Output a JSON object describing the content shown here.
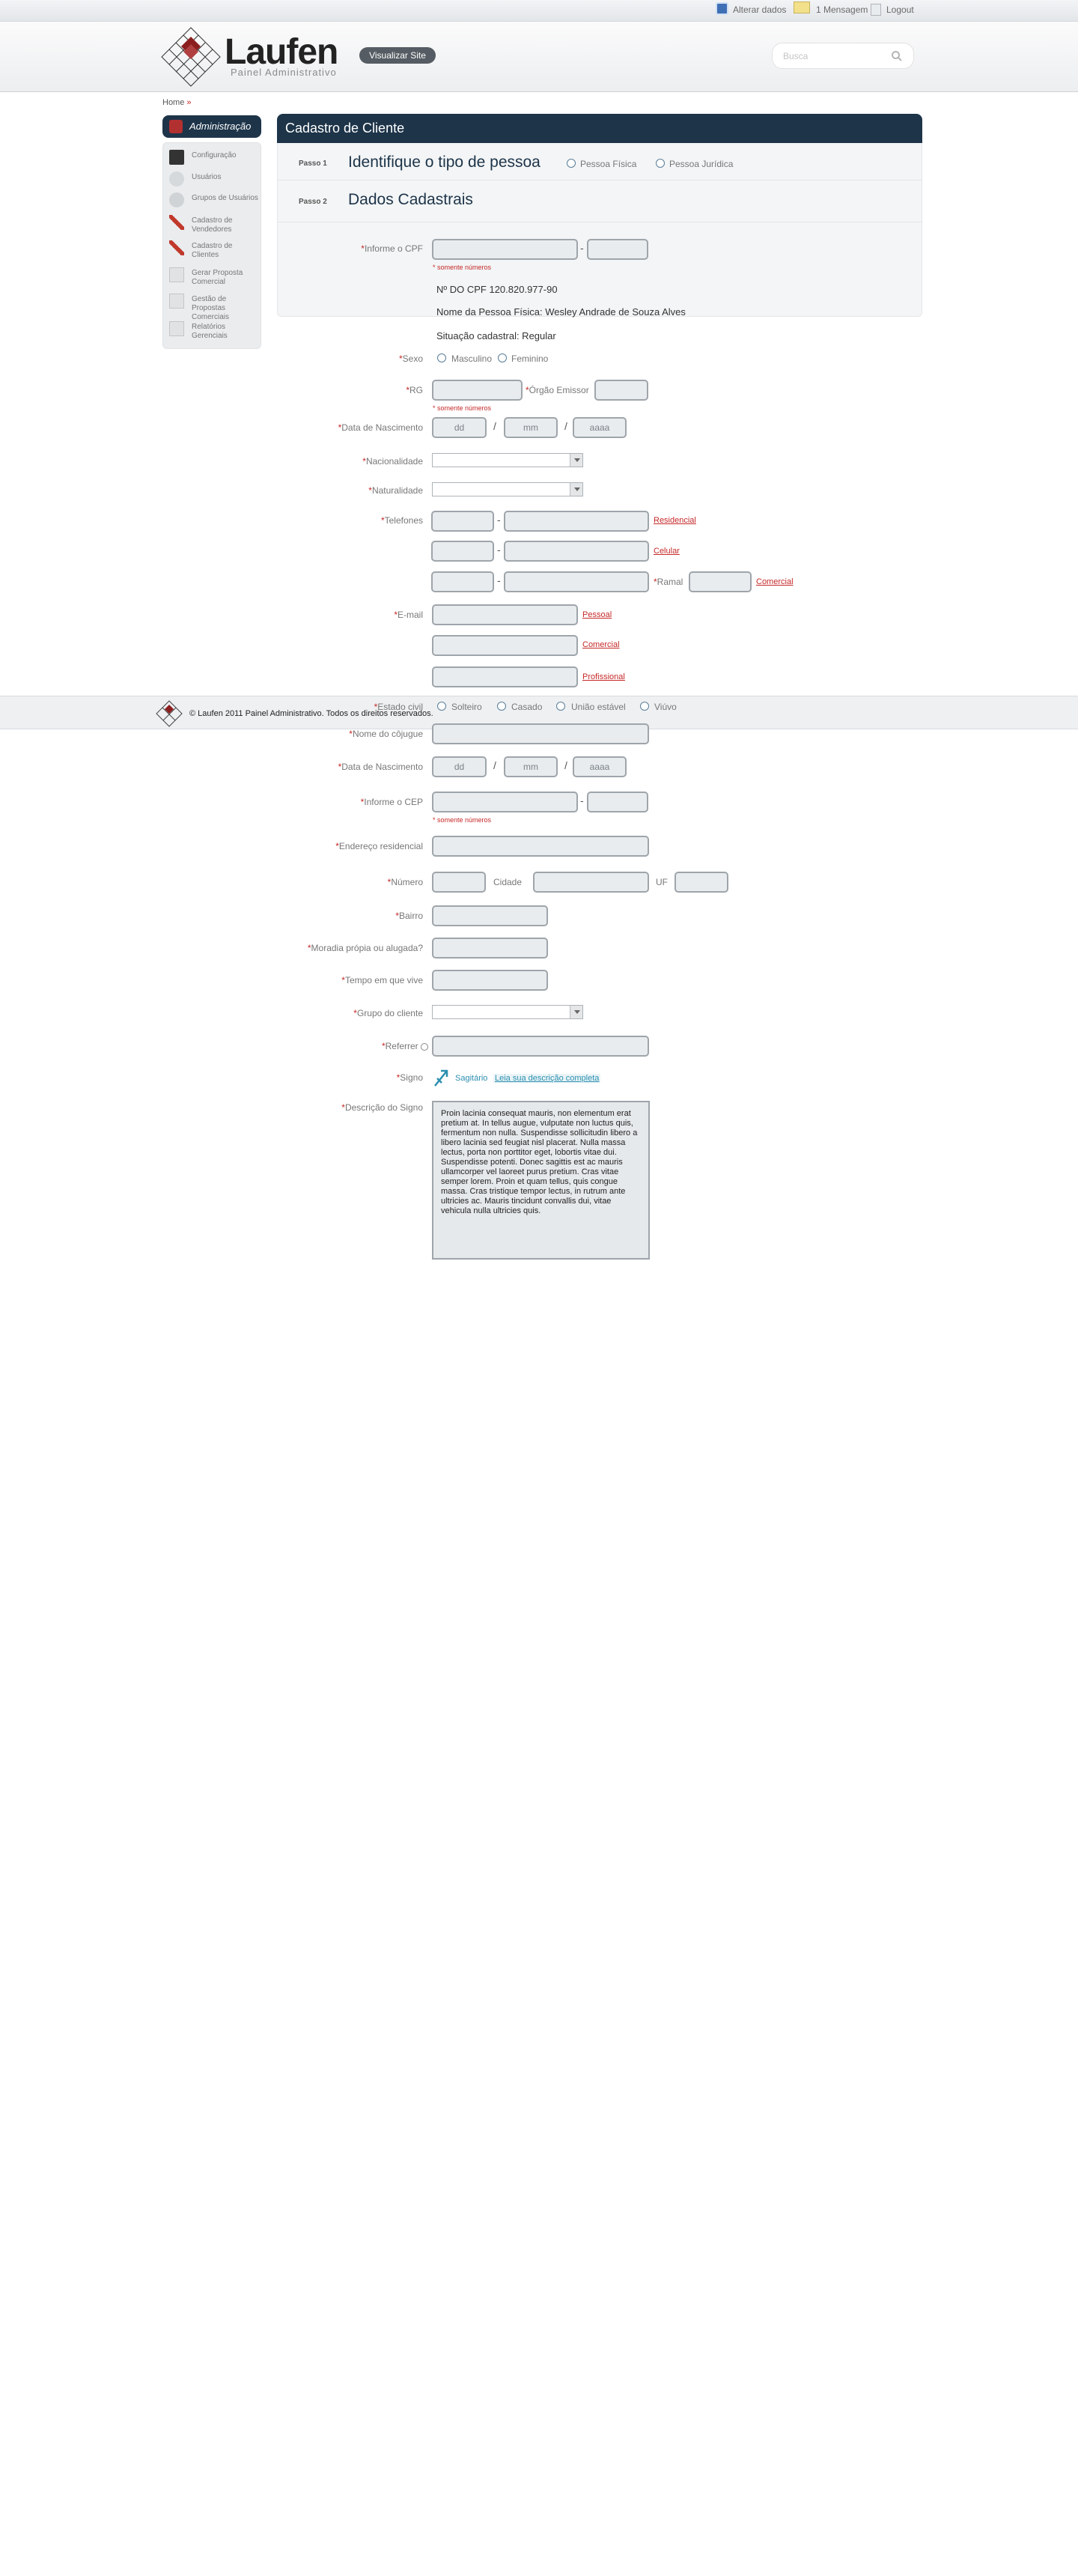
{
  "topbar": {
    "alterar": "Alterar dados",
    "mensagem": "1 Mensagem",
    "logout": "Logout"
  },
  "header": {
    "logo_title": "Laufen",
    "logo_subtitle": "Painel Administrativo",
    "visualizar": "Visualizar Site",
    "search_placeholder": "Busca"
  },
  "breadcrumb": {
    "home": "Home",
    "sep": "»"
  },
  "sidebar": {
    "title": "Administração",
    "items": [
      {
        "label": "Configuração",
        "icon": "tools-icon"
      },
      {
        "label": "Usuários",
        "icon": "user-icon"
      },
      {
        "label": "Grupos de Usuários",
        "icon": "users-group-icon"
      },
      {
        "label": "Cadastro de Vendedores",
        "icon": "pencil-icon"
      },
      {
        "label": "Cadastro de Clientes",
        "icon": "pencil-icon"
      },
      {
        "label": "Gerar Proposta Comercial",
        "icon": "document-icon"
      },
      {
        "label": "Gestão de Propostas Comerciais",
        "icon": "document-icon"
      },
      {
        "label": "Relatórios Gerenciais",
        "icon": "document-icon"
      }
    ]
  },
  "main": {
    "title": "Cadastro de Cliente",
    "step1": {
      "label": "Passo 1",
      "title": "Identifique o tipo de pessoa",
      "opt1": "Pessoa Física",
      "opt2": "Pessoa Jurídica"
    },
    "step2": {
      "label": "Passo 2",
      "title": "Dados Cadastrais"
    }
  },
  "form": {
    "cpf": {
      "label": "Informe o CPF",
      "sep": "-",
      "note": "* somente números"
    },
    "info": {
      "cpf": "Nº DO CPF 120.820.977-90",
      "nome": "Nome da Pessoa Física: Wesley Andrade de Souza Alves",
      "situacao": "Situação cadastral: Regular"
    },
    "sexo": {
      "label": "Sexo",
      "opt1": "Masculino",
      "opt2": "Feminino"
    },
    "rg": {
      "label": "RG",
      "orgao": "Órgão Emissor",
      "note": "* somente números"
    },
    "nascimento": {
      "label": "Data de Nascimento",
      "dd": "dd",
      "mm": "mm",
      "aaaa": "aaaa",
      "slash": "/"
    },
    "nacionalidade": {
      "label": "Nacionalidade"
    },
    "naturalidade": {
      "label": "Naturalidade"
    },
    "telefones": {
      "label": "Telefones",
      "sep": "-",
      "residencial": "Residencial",
      "celular": "Celular",
      "ramal": "Ramal",
      "comercial": "Comercial"
    },
    "email": {
      "label": "E-mail",
      "pessoal": "Pessoal",
      "comercial": "Comercial",
      "profissional": "Profissional"
    },
    "estado_civil": {
      "label": "Estado civil",
      "opt1": "Solteiro",
      "opt2": "Casado",
      "opt3": "União estável",
      "opt4": "Viúvo"
    },
    "conjuge": {
      "label": "Nome do côjugue"
    },
    "nascimento2": {
      "label": "Data de Nascimento",
      "dd": "dd",
      "mm": "mm",
      "aaaa": "aaaa"
    },
    "cep": {
      "label": "Informe o CEP",
      "sep": "-",
      "note": "* somente números"
    },
    "endereco": {
      "label": "Endereço residencial"
    },
    "numero": {
      "label": "Número",
      "cidade": "Cidade",
      "uf": "UF"
    },
    "bairro": {
      "label": "Bairro"
    },
    "moradia": {
      "label": "Moradia própia ou alugada?"
    },
    "tempo": {
      "label": "Tempo em que vive"
    },
    "grupo": {
      "label": "Grupo do cliente"
    },
    "referrer": {
      "label": "Referrer"
    },
    "signo": {
      "label": "Signo",
      "nome": "Sagitário",
      "link": "Leia sua descrição completa"
    },
    "descricao": {
      "label": "Descrição do Signo",
      "text": "Proin lacinia consequat mauris, non elementum erat pretium at. In tellus augue, vulputate non luctus quis, fermentum non nulla. Suspendisse sollicitudin libero a libero lacinia sed feugiat nisl placerat. Nulla massa lectus, porta non porttitor eget, lobortis vitae dui. Suspendisse potenti. Donec sagittis est ac mauris ullamcorper vel laoreet purus pretium. Cras vitae semper lorem. Proin et quam tellus, quis congue massa. Cras tristique tempor lectus, in rutrum ante ultricies ac. Mauris tincidunt convallis dui, vitae vehicula nulla ultricies quis."
    }
  },
  "footer": {
    "text": "© Laufen 2011 Painel Administrativo. Todos os direitos reservados."
  },
  "colors": {
    "navy": "#1d3449",
    "required": "#c62828",
    "link": "#2c8fb0"
  }
}
